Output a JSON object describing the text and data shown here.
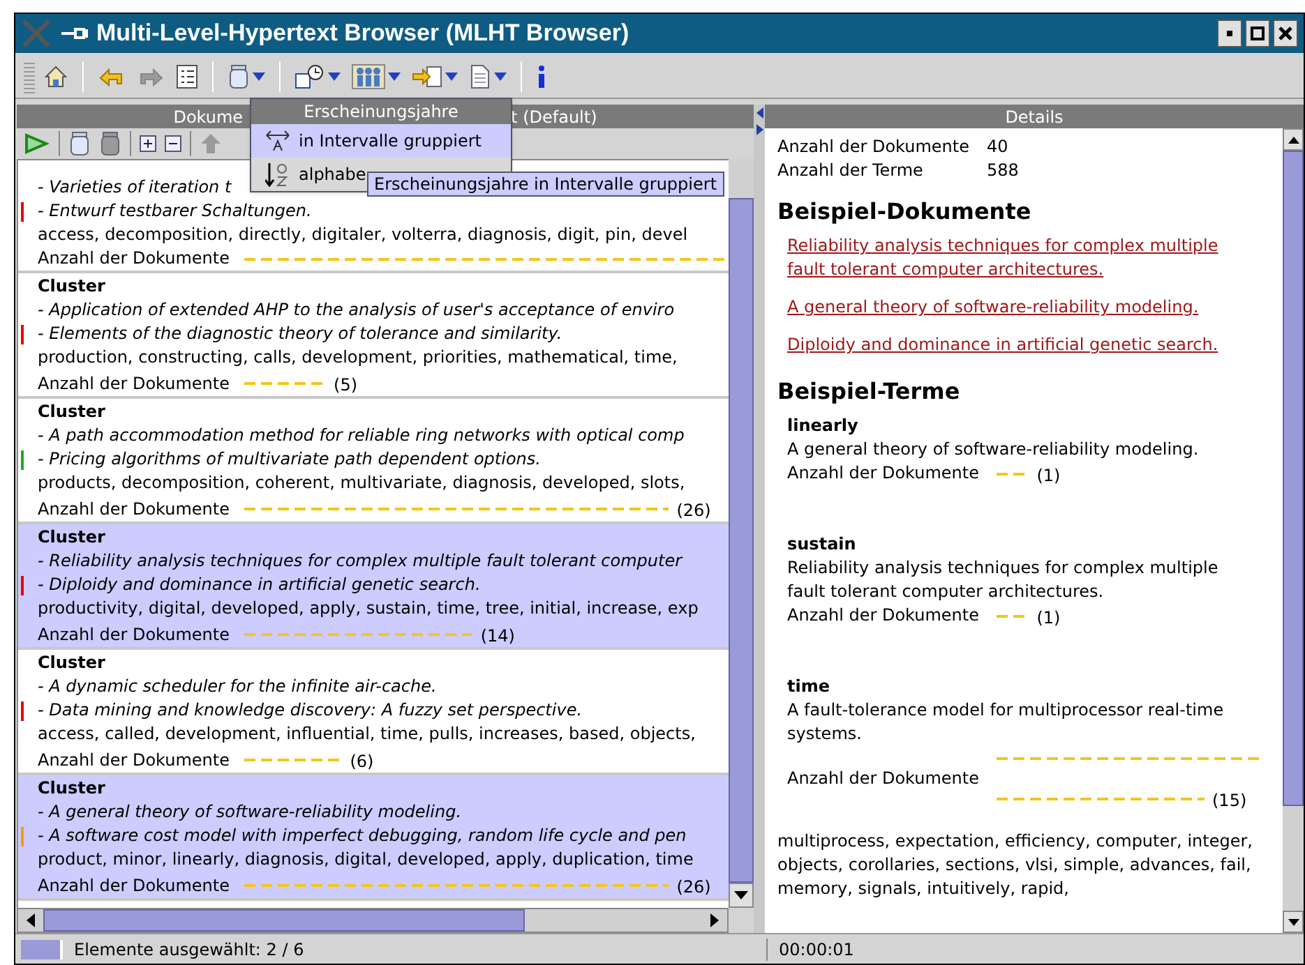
{
  "window": {
    "title": "Multi-Level-Hypertext Browser (MLHT Browser)"
  },
  "toolbar": [
    {
      "kind": "home"
    },
    {
      "kind": "back",
      "disabled": false
    },
    {
      "kind": "forward",
      "disabled": true
    },
    {
      "kind": "list"
    },
    {
      "kind": "jar",
      "menu": true
    },
    {
      "kind": "calendar",
      "menu": true
    },
    {
      "kind": "people",
      "menu": true
    },
    {
      "kind": "import",
      "menu": true
    },
    {
      "kind": "document",
      "menu": true
    },
    {
      "kind": "info"
    }
  ],
  "left_panel": {
    "header_parts": [
      "Dokume",
      "t (Default)"
    ],
    "tools": [
      {
        "kind": "play",
        "disabled": false
      },
      {
        "kind": "jar",
        "disabled": false
      },
      {
        "kind": "jar",
        "disabled": true
      },
      {
        "kind": "expand",
        "disabled": false
      },
      {
        "kind": "collapse",
        "disabled": false
      },
      {
        "kind": "up",
        "disabled": true
      }
    ],
    "clusters": [
      {
        "selected": false,
        "color": "#ee0000",
        "docs": [
          "- Varieties of iteration t",
          "- Entwurf testbarer Schaltungen."
        ],
        "terms": "access, decomposition, directly, digitaler, volterra, diagnosis, digit, pin, devel",
        "count_label": "Anzahl der Dokumente"
      },
      {
        "title": "Cluster",
        "selected": false,
        "color": "#ee0000",
        "docs": [
          "- Application of extended AHP to the analysis of user's acceptance of enviro",
          "- Elements of the diagnostic theory of tolerance and similarity."
        ],
        "terms": "production, constructing, calls, development, priorities, mathematical, time,",
        "count_label": "Anzahl der Dokumente",
        "count": "(5)"
      },
      {
        "title": "Cluster",
        "selected": false,
        "color": "#22aa22",
        "docs": [
          "- A path accommodation method for reliable ring networks with optical comp",
          "- Pricing algorithms of multivariate path dependent options."
        ],
        "terms": "products, decomposition, coherent, multivariate, diagnosis, developed, slots,",
        "count_label": "Anzahl der Dokumente",
        "count": "(26)"
      },
      {
        "title": "Cluster",
        "selected": true,
        "color": "#ee0000",
        "docs": [
          "- Reliability analysis techniques for complex multiple fault tolerant computer",
          "- Diploidy and dominance in artificial genetic search."
        ],
        "terms": "productivity, digital, developed, apply, sustain, time, tree, initial, increase, exp",
        "count_label": "Anzahl der Dokumente",
        "count": "(14)"
      },
      {
        "title": "Cluster",
        "selected": false,
        "color": "#ee0000",
        "docs": [
          "- A dynamic scheduler for the infinite air-cache.",
          "- Data mining and knowledge discovery: A fuzzy set perspective."
        ],
        "terms": "access, called, development, influential, time, pulls, increases, based, objects,",
        "count_label": "Anzahl der Dokumente",
        "count": "(6)"
      },
      {
        "title": "Cluster",
        "selected": true,
        "color": "#ff9900",
        "docs": [
          "- A general theory of software-reliability modeling.",
          "- A software cost model with imperfect debugging, random life cycle and pen"
        ],
        "terms": "product, minor, linearly, diagnosis, digital, developed, apply, duplication, time",
        "count_label": "Anzahl der Dokumente",
        "count": "(26)"
      }
    ]
  },
  "menu": {
    "title": "Erscheinungsjahre",
    "items": [
      {
        "kind": "interval",
        "label": "in Intervalle gruppiert",
        "selected": true
      },
      {
        "kind": "alpha",
        "label": "alphabe",
        "selected": false
      }
    ]
  },
  "tooltip": "Erscheinungsjahre in Intervalle gruppiert",
  "details": {
    "header": "Details",
    "stats": [
      {
        "label": "Anzahl der Dokumente",
        "value": "40"
      },
      {
        "label": "Anzahl der Terme",
        "value": "588"
      }
    ],
    "docs_heading": "Beispiel-Dokumente",
    "docs": [
      "Reliability analysis techniques for complex multiple fault tolerant computer architectures.",
      "A general theory of software-reliability modeling.",
      "Diploidy and dominance in artificial genetic search."
    ],
    "terms_heading": "Beispiel-Terme",
    "terms": [
      {
        "term": "linearly",
        "doc": "A general theory of software-reliability modeling.",
        "count_label": "Anzahl der Dokumente",
        "count": "(1)"
      },
      {
        "term": "sustain",
        "doc": "Reliability analysis techniques for complex multiple fault tolerant computer architectures.",
        "count_label": "Anzahl der Dokumente",
        "count": "(1)"
      },
      {
        "term": "time",
        "doc": "A fault-tolerance model for multiprocessor real-time systems.",
        "count_label": "Anzahl der Dokumente",
        "count": "(15)"
      }
    ],
    "term_list": "multiprocess, expectation, efficiency, computer, integer, objects, corollaries, sections, vlsi, simple, advances, fail, memory, signals, intuitively, rapid,"
  },
  "status_bar": {
    "selection": "Elemente ausgewählt: 2 / 6",
    "time": "00:00:01"
  }
}
